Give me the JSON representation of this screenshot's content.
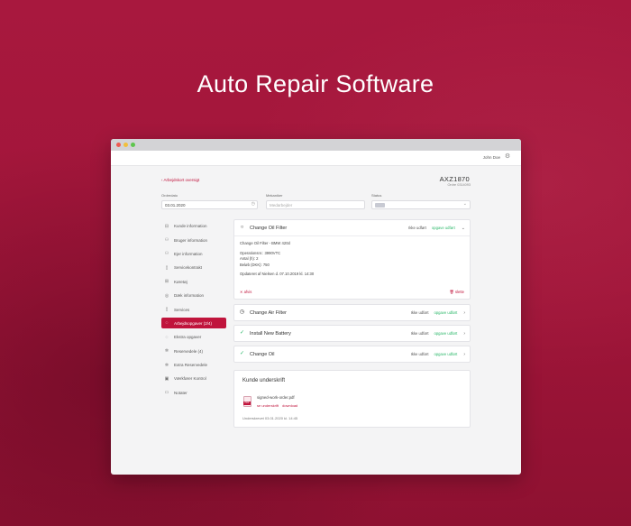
{
  "hero": {
    "title": "Auto Repair Software"
  },
  "appbar": {
    "user": "John Doe",
    "settings_icon": "gear-icon"
  },
  "order": {
    "back_label": "‹ Arbejdskort oversigt",
    "number": "AXZ1870",
    "sub": "Ordre 0314093"
  },
  "filters": {
    "date_label": "Ordredato",
    "date_value": "03.01.2020",
    "mechanic_label": "Mekaniker",
    "mechanic_placeholder": "Medarbejder",
    "status_label": "Status"
  },
  "sidebar": {
    "items": [
      {
        "label": "Kunde information",
        "icon": "car-icon",
        "glyph": "⊟",
        "active": false
      },
      {
        "label": "Bruger information",
        "icon": "user-icon",
        "glyph": "⚇",
        "active": false
      },
      {
        "label": "Ejer information",
        "icon": "owner-icon",
        "glyph": "⚇",
        "active": false
      },
      {
        "label": "Servicekontrakt",
        "icon": "document-icon",
        "glyph": "▯",
        "active": false
      },
      {
        "label": "Køretøj",
        "icon": "vehicle-icon",
        "glyph": "⊞",
        "active": false
      },
      {
        "label": "Dæk information",
        "icon": "tire-icon",
        "glyph": "◎",
        "active": false
      },
      {
        "label": "Services",
        "icon": "file-icon",
        "glyph": "▯",
        "active": false
      },
      {
        "label": "Arbejdsopgaver (2/4)",
        "icon": "check-circle-icon",
        "glyph": "◌",
        "active": true
      },
      {
        "label": "Ekstra opgaver",
        "icon": "extra-task-icon",
        "glyph": "◌",
        "active": false
      },
      {
        "label": "Reservedele (4)",
        "icon": "parts-icon",
        "glyph": "✲",
        "active": false
      },
      {
        "label": "Extra Reservedele",
        "icon": "extra-parts-icon",
        "glyph": "✲",
        "active": false
      },
      {
        "label": "Værkfører Kontrol",
        "icon": "lock-icon",
        "glyph": "▣",
        "active": false
      },
      {
        "label": "Notater",
        "icon": "notes-icon",
        "glyph": "▭",
        "active": false
      }
    ]
  },
  "tasks": [
    {
      "name": "Change Oil Filter",
      "icon": "circle-icon",
      "glyph": "○",
      "status_text": "Ikke udført",
      "done_label": "opgave udført",
      "expanded": true,
      "details": {
        "title": "Change Oil Filter - BMW 420d",
        "operation": "Operationsnr.: 3990VTC",
        "quantity": "Antal (h): 2",
        "amount": "Beløb (DKK): 750",
        "updated": "Opdateret af Nielsen d. 07.10.2019 kl. 14:30",
        "reject_label": "✕ afvis",
        "delete_label": "🗑 slette"
      }
    },
    {
      "name": "Change Air Filter",
      "icon": "clock-icon",
      "glyph": "◷",
      "status_text": "Ikke udført",
      "done_label": "opgave udført",
      "expanded": false
    },
    {
      "name": "Install New Battery",
      "icon": "check-circle-icon",
      "glyph": "✓",
      "status_text": "Ikke udført",
      "done_label": "opgave udført",
      "expanded": false
    },
    {
      "name": "Change Oil",
      "icon": "check-circle-icon",
      "glyph": "✓",
      "status_text": "Ikke udført",
      "done_label": "opgave udført",
      "expanded": false
    }
  ],
  "signature": {
    "title": "Kunde underskrift",
    "file_name": "signed-work-order.pdf",
    "view_link": "se underskrift",
    "download_link": "download",
    "pdf_tag": "PDF",
    "signed_at": "Underskrevet 03.01.2020 kl. 14:45"
  },
  "colors": {
    "brand": "#c0143c",
    "success": "#2cb86a",
    "background": "#a3163a"
  }
}
